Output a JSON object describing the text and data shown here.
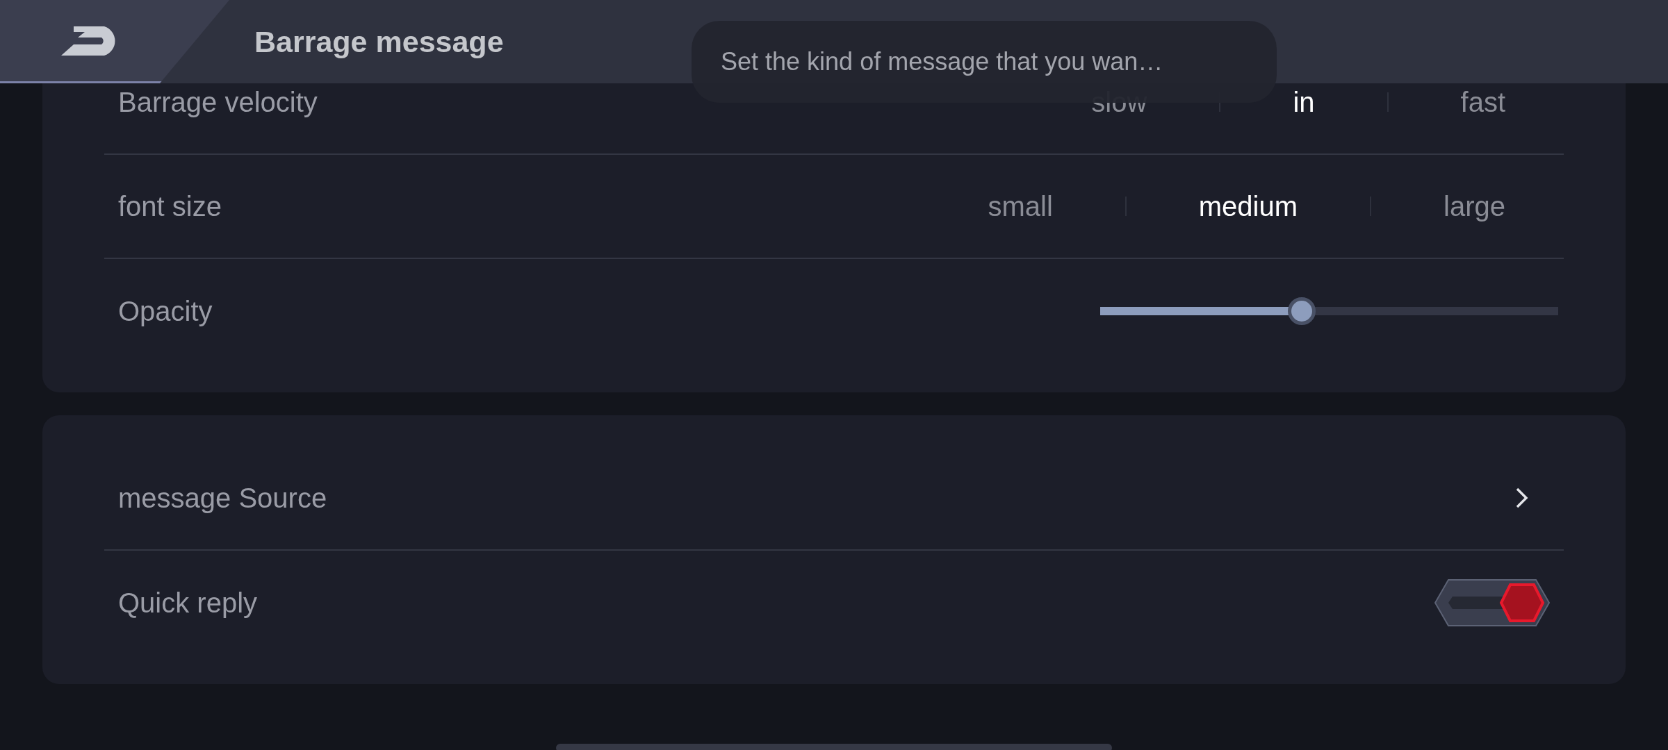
{
  "header": {
    "title": "Barrage message"
  },
  "toast": {
    "text": "Set the kind of message that you wan…"
  },
  "display_settings": [
    {
      "kind": "segmented",
      "label": "Barrage velocity",
      "options": [
        {
          "label": "slow",
          "selected": false
        },
        {
          "label": "in",
          "selected": true
        },
        {
          "label": "fast",
          "selected": false
        }
      ]
    },
    {
      "kind": "segmented",
      "label": "font size",
      "options": [
        {
          "label": "small",
          "selected": false
        },
        {
          "label": "medium",
          "selected": true
        },
        {
          "label": "large",
          "selected": false
        }
      ]
    },
    {
      "kind": "slider",
      "label": "Opacity",
      "level": 0.44
    }
  ],
  "message_settings": [
    {
      "kind": "link",
      "label": "message Source"
    },
    {
      "kind": "toggle",
      "label": "Quick reply",
      "on": true
    }
  ]
}
